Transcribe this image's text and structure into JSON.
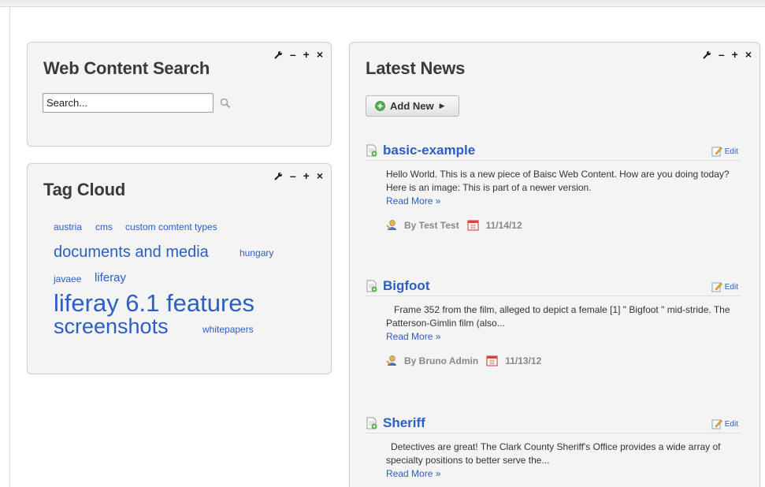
{
  "search_portlet": {
    "title": "Web Content Search",
    "placeholder": "Search...",
    "value": "Search..."
  },
  "tag_portlet": {
    "title": "Tag Cloud",
    "tags": [
      "austria",
      "cms",
      "custom comtent types",
      "documents and media",
      "hungary",
      "javaee",
      "liferay",
      "liferay 6.1 features",
      "screenshots",
      "whitepapers"
    ]
  },
  "news_portlet": {
    "title": "Latest News",
    "add_new_label": "Add New",
    "edit_label": "Edit",
    "read_more_label": "Read More »",
    "articles": [
      {
        "title": "basic-example",
        "body": "Hello World. This is a new piece of Baisc Web Content. How are you doing today?  Here is an image:   This is part of a newer version.",
        "author": "By Test Test",
        "date": "11/14/12"
      },
      {
        "title": "Bigfoot",
        "body": "Frame 352 from the film, alleged to depict a female [1]  \" Bigfoot \" mid-stride. The  Patterson-Gimlin film  (also...",
        "author": "By Bruno Admin",
        "date": "11/13/12"
      },
      {
        "title": "Sheriff",
        "body": "Detectives are great! The Clark County Sheriff's Office provides a wide array of specialty positions to better serve the..."
      }
    ]
  },
  "portlet_controls": {
    "minimize": "–",
    "maximize": "+",
    "close": "×"
  },
  "icons": [
    "wrench-icon",
    "search-icon",
    "add-icon",
    "dropdown-arrow-icon",
    "article-icon",
    "edit-icon",
    "user-icon",
    "calendar-icon"
  ],
  "colors": {
    "link": "#2b5ec6",
    "panel": "#f4f4f4",
    "add_icon": "#4caf50"
  }
}
